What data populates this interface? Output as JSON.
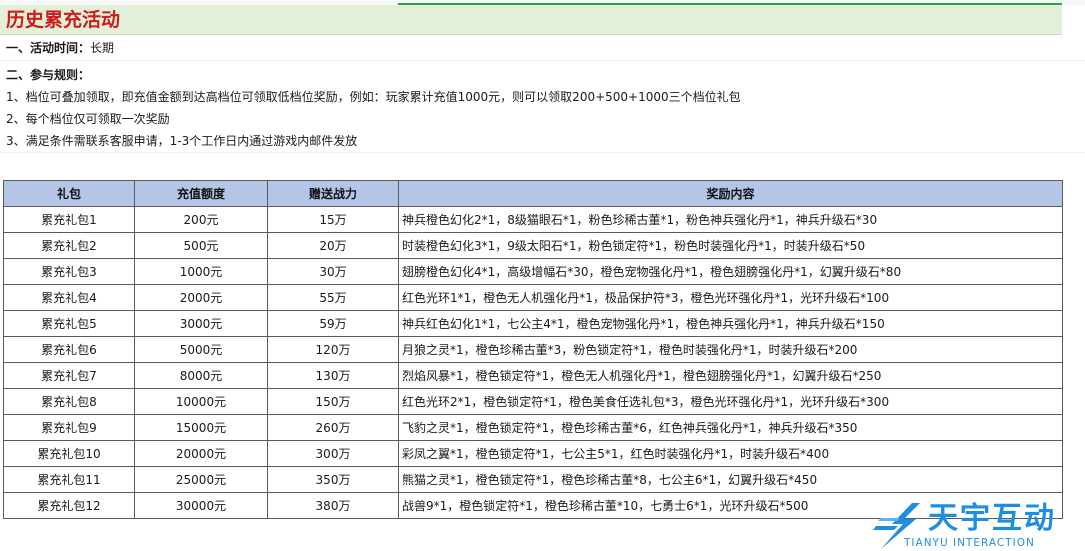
{
  "sheet": {
    "title": "历史累充活动",
    "activity_time_label": "一、活动时间：",
    "activity_time_value": "长期",
    "rules_heading": "二、参与规则：",
    "rules": [
      "1、档位可叠加领取，即充值金额到达高档位可领取低档位奖励，例如：玩家累计充值1000元，则可以领取200+500+1000三个档位礼包",
      "2、每个档位仅可领取一次奖励",
      "3、满足条件需联系客服申请，1-3个工作日内通过游戏内邮件发放"
    ]
  },
  "table": {
    "headers": [
      "礼包",
      "充值额度",
      "赠送战力",
      "奖励内容"
    ],
    "rows": [
      [
        "累充礼包1",
        "200元",
        "15万",
        "神兵橙色幻化2*1，8级猫眼石*1，粉色珍稀古董*1，粉色神兵强化丹*1，神兵升级石*30"
      ],
      [
        "累充礼包2",
        "500元",
        "20万",
        "时装橙色幻化3*1，9级太阳石*1，粉色锁定符*1，粉色时装强化丹*1，时装升级石*50"
      ],
      [
        "累充礼包3",
        "1000元",
        "30万",
        "翅膀橙色幻化4*1，高级增幅石*30，橙色宠物强化丹*1，橙色翅膀强化丹*1，幻翼升级石*80"
      ],
      [
        "累充礼包4",
        "2000元",
        "55万",
        "红色光环1*1，橙色无人机强化丹*1，极品保护符*3，橙色光环强化丹*1，光环升级石*100"
      ],
      [
        "累充礼包5",
        "3000元",
        "59万",
        "神兵红色幻化1*1，七公主4*1，橙色宠物强化丹*1，橙色神兵强化丹*1，神兵升级石*150"
      ],
      [
        "累充礼包6",
        "5000元",
        "120万",
        "月狼之灵*1，橙色珍稀古董*3，粉色锁定符*1，橙色时装强化丹*1，时装升级石*200"
      ],
      [
        "累充礼包7",
        "8000元",
        "130万",
        "烈焰风暴*1，橙色锁定符*1，橙色无人机强化丹*1，橙色翅膀强化丹*1，幻翼升级石*250"
      ],
      [
        "累充礼包8",
        "10000元",
        "150万",
        "红色光环2*1，橙色锁定符*1，橙色美食任选礼包*3，橙色光环强化丹*1，光环升级石*300"
      ],
      [
        "累充礼包9",
        "15000元",
        "260万",
        "飞豹之灵*1，橙色锁定符*1，橙色珍稀古董*6，红色神兵强化丹*1，神兵升级石*350"
      ],
      [
        "累充礼包10",
        "20000元",
        "300万",
        "彩凤之翼*1，橙色锁定符*1，七公主5*1，红色时装强化丹*1，时装升级石*400"
      ],
      [
        "累充礼包11",
        "25000元",
        "350万",
        "熊猫之灵*1，橙色锁定符*1，橙色珍稀古董*8，七公主6*1，幻翼升级石*450"
      ],
      [
        "累充礼包12",
        "30000元",
        "380万",
        "战兽9*1，橙色锁定符*1，橙色珍稀古董*10，七勇士6*1，光环升级石*500"
      ]
    ]
  },
  "logo": {
    "name": "天宇互动",
    "subtitle": "TIANYU INTERACTION",
    "color": "#1e8fe0"
  }
}
